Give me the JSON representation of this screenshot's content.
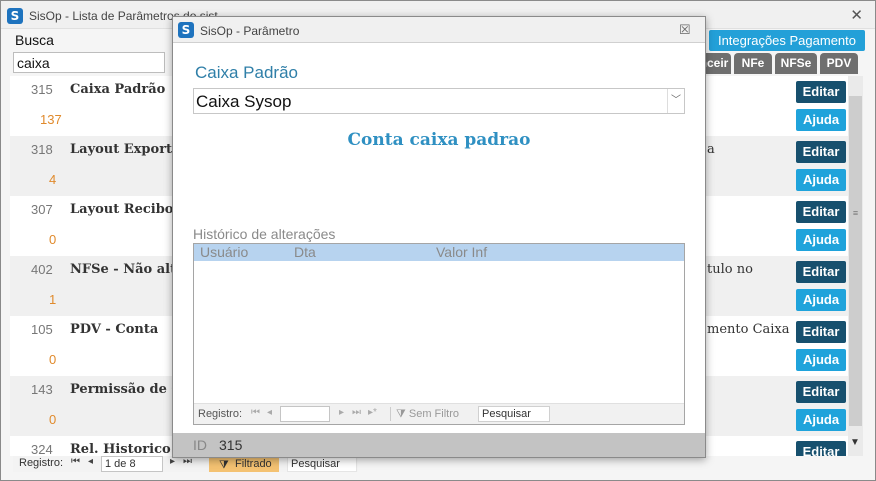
{
  "main": {
    "title": "SisOp - Lista de Parâmetros do sist",
    "close_glyph": "✕",
    "search_label": "Busca",
    "search_value": "caixa",
    "integrations_button": "Integrações Pagamento",
    "tabs": [
      "nceir",
      "NFe",
      "NFSe",
      "PDV"
    ],
    "edit_label": "Editar",
    "help_label": "Ajuda",
    "rows": [
      {
        "id": "315",
        "name": "Caixa Padrão",
        "count": "137",
        "desc": "",
        "desc2": ""
      },
      {
        "id": "318",
        "name": "Layout Exporta",
        "count": "4",
        "desc": "a",
        "desc2": ""
      },
      {
        "id": "307",
        "name": "Layout Recibos",
        "count": "0",
        "desc": "",
        "desc2": ""
      },
      {
        "id": "402",
        "name": "NFSe - Não alte",
        "count": "1",
        "desc": "tulo no",
        "desc2": ""
      },
      {
        "id": "105",
        "name": "PDV - Conta",
        "count": "0",
        "desc": "mento Caixa",
        "desc2": ""
      },
      {
        "id": "143",
        "name": "Permissão de C",
        "count": "0",
        "desc": "",
        "desc2": ""
      },
      {
        "id": "324",
        "name": "Rel. Historico C",
        "count": "",
        "desc": "",
        "desc2": ""
      }
    ],
    "navigator": {
      "label": "Registro:",
      "position": "1 de 8",
      "filtered": "Filtrado",
      "search": "Pesquisar"
    }
  },
  "dialog": {
    "title": "SisOp - Parâmetro",
    "close_glyph": "☒",
    "field_label": "Caixa Padrão",
    "field_value": "Caixa Sysop",
    "description": "Conta caixa padrao",
    "history_label": "Histórico de alterações",
    "history_columns": [
      "Usuário",
      "Dta",
      "Valor Inf"
    ],
    "history_navigator": {
      "label": "Registro:",
      "no_filter": "Sem Filtro",
      "search": "Pesquisar"
    },
    "id_label": "ID",
    "id_value": "315"
  },
  "colors": {
    "accent_blue": "#1fa3db",
    "edit_dark": "#17506e",
    "count_orange": "#e08a2c",
    "filter_yellow": "#f4c272"
  }
}
